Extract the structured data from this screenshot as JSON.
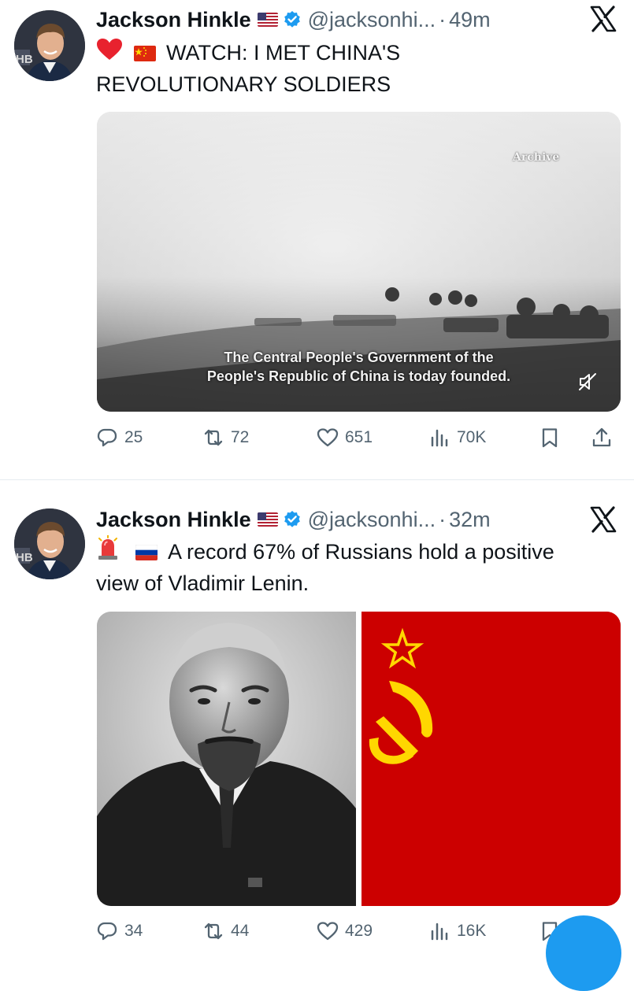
{
  "tweets": [
    {
      "author_name": "Jackson Hinkle",
      "handle": "@jacksonhi...",
      "separator": "·",
      "time": "49m",
      "text_line1": "WATCH: I MET CHINA'S",
      "text_line2": "REVOLUTIONARY SOLDIERS",
      "leading_emoji": [
        "red-heart",
        "china-flag"
      ],
      "media": {
        "type": "video",
        "watermark": "Archive",
        "caption_line1": "The Central People's Government of the",
        "caption_line2": "People's Republic of China is today founded.",
        "muted": true
      },
      "actions": {
        "replies": "25",
        "reposts": "72",
        "likes": "651",
        "views": "70K"
      }
    },
    {
      "author_name": "Jackson Hinkle",
      "handle": "@jacksonhi...",
      "separator": "·",
      "time": "32m",
      "text_line1": "A record 67% of Russians hold a positive",
      "text_line2": "view of Vladimir Lenin.",
      "leading_emoji": [
        "police-light",
        "russia-flag"
      ],
      "media": {
        "type": "image-pair",
        "left": "portrait-photo",
        "right": "soviet-flag"
      },
      "actions": {
        "replies": "34",
        "reposts": "44",
        "likes": "429",
        "views": "16K"
      }
    }
  ],
  "colors": {
    "text": "#0f1419",
    "secondary": "#536471",
    "verified": "#1d9bf0",
    "soviet_red": "#cc0000",
    "soviet_gold": "#ffd700"
  },
  "icons": [
    "x-logo-icon",
    "verified-badge-icon",
    "reply-icon",
    "repost-icon",
    "like-icon",
    "views-icon",
    "bookmark-icon",
    "share-icon",
    "mute-icon"
  ]
}
